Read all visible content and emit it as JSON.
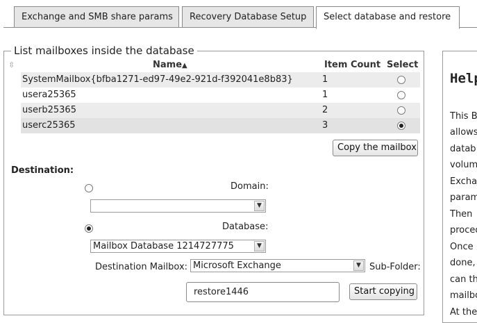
{
  "tabs": [
    {
      "label": "Exchange and SMB share params",
      "active": false
    },
    {
      "label": "Recovery Database Setup",
      "active": false
    },
    {
      "label": "Select database and restore",
      "active": true
    }
  ],
  "mailbox_section": {
    "legend": "List mailboxes inside the database",
    "columns": {
      "name": "Name",
      "sort_indicator": "▲",
      "item_count": "Item Count",
      "select": "Select"
    },
    "rows": [
      {
        "name": "SystemMailbox{bfba1271-ed97-49e2-921d-f392041e8b83}",
        "item_count": "1",
        "selected": false
      },
      {
        "name": "usera25365",
        "item_count": "1",
        "selected": false
      },
      {
        "name": "userb25365",
        "item_count": "2",
        "selected": false
      },
      {
        "name": "userc25365",
        "item_count": "3",
        "selected": true
      }
    ],
    "copy_button": "Copy the mailbox"
  },
  "destination": {
    "label": "Destination:",
    "domain_label": "Domain:",
    "domain_value": "",
    "domain_selected": false,
    "database_label": "Database:",
    "database_value": "Mailbox Database 1214727775",
    "database_selected": true,
    "mailbox_label": "Destination Mailbox:",
    "mailbox_value": "Microsoft Exchange",
    "subfolder_label": "Sub-Folder:",
    "subfolder_value": "restore1446",
    "start_button": "Start copying"
  },
  "help": {
    "title": "Help",
    "title_visible": "Help",
    "lines": [
      "This B",
      "allows",
      "datab",
      "volum",
      "Excha",
      "param",
      "Then",
      "proced",
      "Once",
      "done,",
      "can th",
      "mailbo",
      "At the"
    ]
  }
}
